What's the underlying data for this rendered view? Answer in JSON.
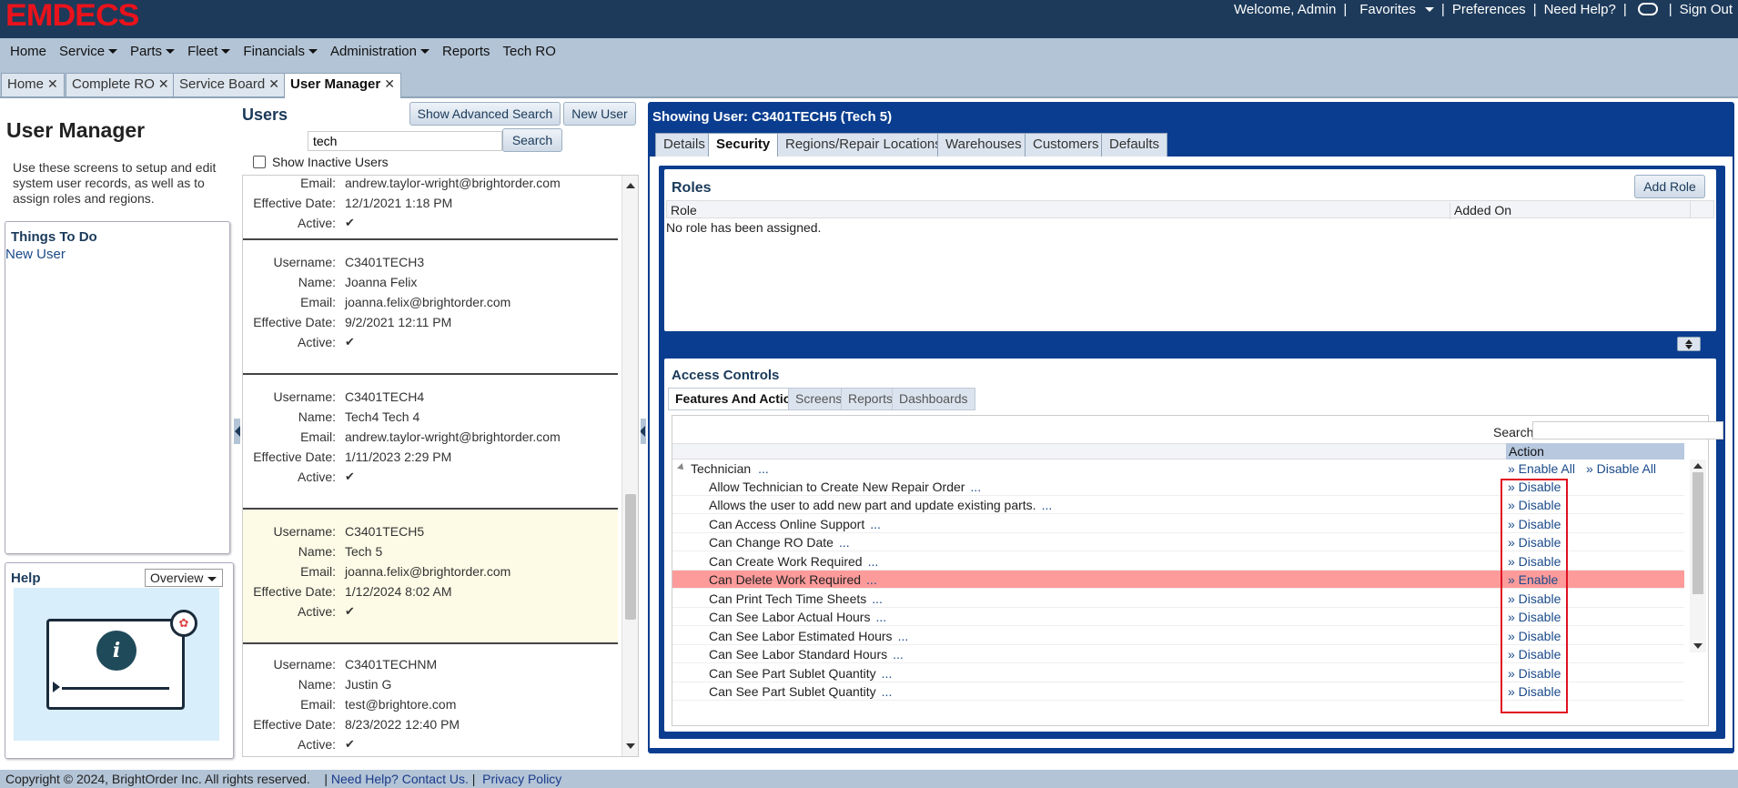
{
  "brand": {
    "logo": "EMDECS",
    "logo_color": "#e8131c"
  },
  "topbar": {
    "welcome": "Welcome, Admin",
    "favorites": "Favorites",
    "preferences": "Preferences",
    "need_help": "Need Help?",
    "sign_out": "Sign Out"
  },
  "menu": [
    "Home",
    "Service",
    "Parts",
    "Fleet",
    "Financials",
    "Administration",
    "Reports",
    "Tech RO"
  ],
  "tabs": [
    {
      "label": "Home"
    },
    {
      "label": "Complete RO"
    },
    {
      "label": "Service Board"
    },
    {
      "label": "User Manager"
    }
  ],
  "left": {
    "title": "User Manager",
    "description": "Use these screens to setup and edit system user records, as well as to assign roles and regions.",
    "things_to_do_title": "Things To Do",
    "things_to_do_link": "New User",
    "help_title": "Help",
    "help_select": "Overview"
  },
  "users": {
    "title": "Users",
    "advanced_search_button": "Show Advanced Search",
    "new_user_button": "New User",
    "search_value": "tech",
    "search_button": "Search",
    "show_inactive_label": "Show Inactive Users",
    "field_labels": {
      "username": "Username:",
      "name": "Name:",
      "email": "Email:",
      "effective_date": "Effective Date:",
      "active": "Active:"
    },
    "partial_card": {
      "email": "andrew.taylor-wright@brightorder.com",
      "effective_date": "12/1/2021 1:18 PM",
      "active": "✔"
    },
    "cards": [
      {
        "username": "C3401TECH3",
        "name": "Joanna Felix",
        "email": "joanna.felix@brightorder.com",
        "effective_date": "9/2/2021 12:11 PM",
        "active": "✔"
      },
      {
        "username": "C3401TECH4",
        "name": "Tech4 Tech 4",
        "email": "andrew.taylor-wright@brightorder.com",
        "effective_date": "1/11/2023 2:29 PM",
        "active": "✔"
      },
      {
        "username": "C3401TECH5",
        "name": "Tech 5",
        "email": "joanna.felix@brightorder.com",
        "effective_date": "1/12/2024 8:02 AM",
        "active": "✔"
      },
      {
        "username": "C3401TECHNM",
        "name": "Justin G",
        "email": "test@brightore.com",
        "effective_date": "8/23/2022 12:40 PM",
        "active": "✔"
      }
    ]
  },
  "detail": {
    "title": "Showing User: C3401TECH5 (Tech 5)",
    "tabs": [
      "Details",
      "Security",
      "Regions/Repair Locations",
      "Warehouses",
      "Customers",
      "Defaults"
    ],
    "roles": {
      "title": "Roles",
      "add_button": "Add Role",
      "col_role": "Role",
      "col_added_on": "Added On",
      "empty": "No role has been assigned."
    },
    "access": {
      "title": "Access Controls",
      "tabs": [
        "Features And Actions",
        "Screens",
        "Reports",
        "Dashboards"
      ],
      "search_label": "Search:",
      "action_header": "Action",
      "group": "Technician",
      "dots": "...",
      "enable_all": "» Enable All",
      "disable_all": "» Disable All",
      "rows": [
        {
          "label": "Allow Technician to Create New Repair Order",
          "action": "» Disable"
        },
        {
          "label": "Allows the user to add new part and update existing parts.",
          "action": "» Disable"
        },
        {
          "label": "Can Access Online Support",
          "action": "» Disable"
        },
        {
          "label": "Can Change RO Date",
          "action": "» Disable"
        },
        {
          "label": "Can Create Work Required",
          "action": "» Disable"
        },
        {
          "label": "Can Delete Work Required",
          "action": "» Enable"
        },
        {
          "label": "Can Print Tech Time Sheets",
          "action": "» Disable"
        },
        {
          "label": "Can See Labor Actual Hours",
          "action": "» Disable"
        },
        {
          "label": "Can See Labor Estimated Hours",
          "action": "» Disable"
        },
        {
          "label": "Can See Labor Standard Hours",
          "action": "» Disable"
        },
        {
          "label": "Can See Part Sublet Quantity",
          "action": "» Disable"
        },
        {
          "label": "Can See Part Sublet Quantity",
          "action": "» Disable"
        }
      ]
    }
  },
  "footer": {
    "copyright": "Copyright © 2024, BrightOrder Inc. All rights reserved.",
    "contact": "Need Help? Contact Us.",
    "privacy": "Privacy Policy"
  }
}
